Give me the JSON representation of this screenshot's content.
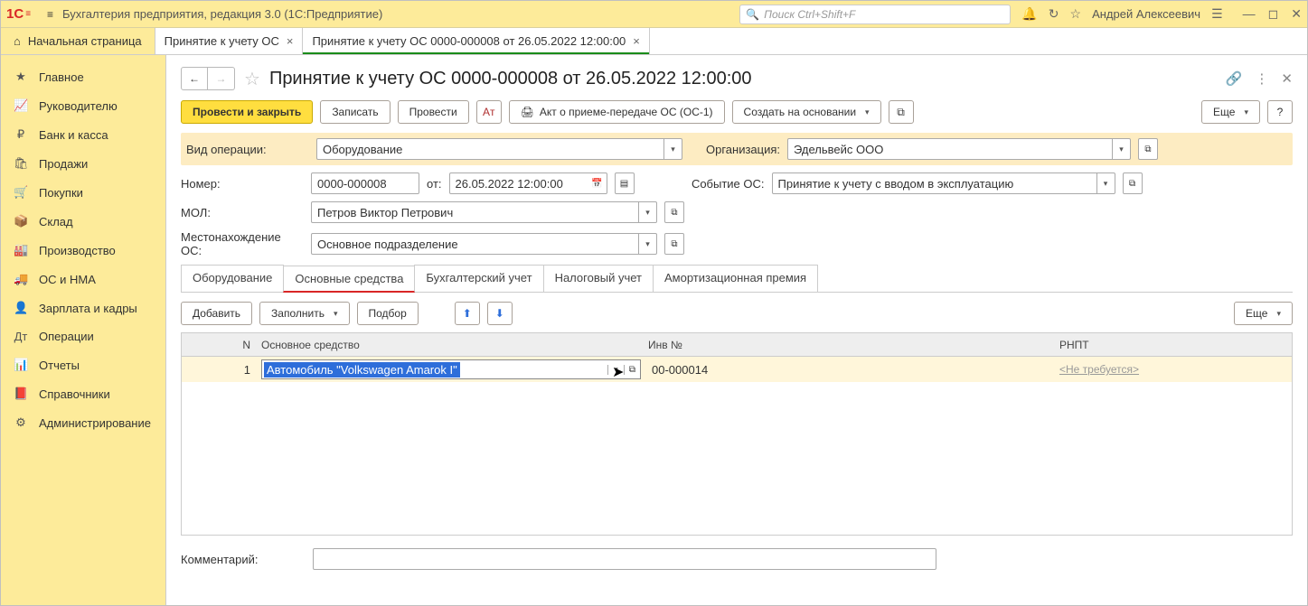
{
  "app_title": "Бухгалтерия предприятия, редакция 3.0  (1С:Предприятие)",
  "search_placeholder": "Поиск Ctrl+Shift+F",
  "user_name": "Андрей Алексеевич",
  "tabs": {
    "home": "Начальная страница",
    "t1": "Принятие к учету ОС",
    "t2": "Принятие к учету ОС 0000-000008 от 26.05.2022 12:00:00"
  },
  "sidebar": [
    "Главное",
    "Руководителю",
    "Банк и касса",
    "Продажи",
    "Покупки",
    "Склад",
    "Производство",
    "ОС и НМА",
    "Зарплата и кадры",
    "Операции",
    "Отчеты",
    "Справочники",
    "Администрирование"
  ],
  "doc_title": "Принятие к учету ОС 0000-000008 от 26.05.2022 12:00:00",
  "cmd": {
    "post_close": "Провести и закрыть",
    "save": "Записать",
    "post": "Провести",
    "act": "Акт о приеме-передаче ОС (ОС-1)",
    "create_based": "Создать на основании",
    "more": "Еще"
  },
  "labels": {
    "op_type": "Вид операции:",
    "number": "Номер:",
    "from": "от:",
    "mol": "МОЛ:",
    "loc": "Местонахождение ОС:",
    "org": "Организация:",
    "event": "Событие ОС:",
    "comment": "Комментарий:",
    "fill": "Заполнить",
    "add": "Добавить",
    "pick": "Подбор"
  },
  "values": {
    "op_type": "Оборудование",
    "number": "0000-000008",
    "date": "26.05.2022 12:00:00",
    "mol": "Петров Виктор Петрович",
    "loc": "Основное подразделение",
    "org": "Эдельвейс ООО",
    "event": "Принятие к учету с вводом в эксплуатацию"
  },
  "subtabs": [
    "Оборудование",
    "Основные средства",
    "Бухгалтерский учет",
    "Налоговый учет",
    "Амортизационная премия"
  ],
  "grid": {
    "headers": {
      "n": "N",
      "os": "Основное средство",
      "inv": "Инв №",
      "rn": "РНПТ"
    },
    "rows": [
      {
        "n": "1",
        "os": "Автомобиль \"Volkswagen Amarok I\"",
        "inv": "00-000014",
        "rn": "<Не требуется>"
      }
    ]
  }
}
